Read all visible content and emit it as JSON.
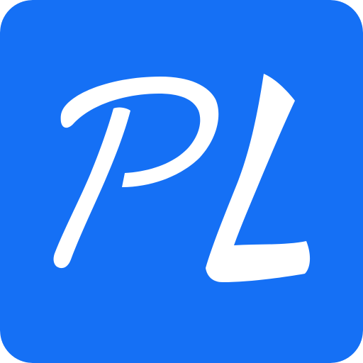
{
  "app_icon": {
    "name": "PL logo",
    "lettering": "PL",
    "colors": {
      "background": "#1570F5",
      "letters": "#FFFFFF"
    }
  }
}
